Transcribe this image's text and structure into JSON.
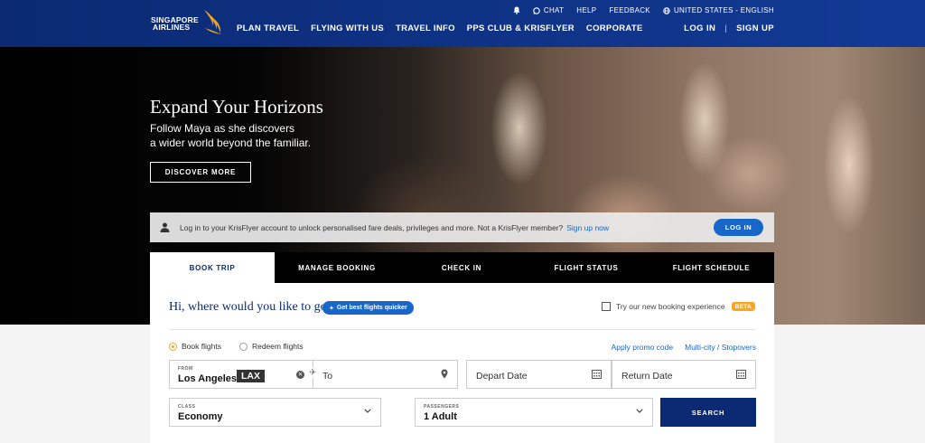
{
  "header": {
    "brand_line1": "SINGAPORE",
    "brand_line2": "AIRLINES",
    "nav": [
      "PLAN TRAVEL",
      "FLYING WITH US",
      "TRAVEL INFO",
      "PPS CLUB & KRISFLYER",
      "CORPORATE"
    ],
    "utility": {
      "chat": "CHAT",
      "help": "HELP",
      "feedback": "FEEDBACK",
      "region": "UNITED STATES - ENGLISH"
    },
    "login": "LOG IN",
    "signup": "SIGN UP",
    "colors": {
      "header_blue": "#0b2a73",
      "accent_gold": "#f6a623",
      "link_blue": "#1866c8"
    }
  },
  "hero": {
    "title": "Expand Your Horizons",
    "subtitle_line1": "Follow Maya as she discovers",
    "subtitle_line2": "a wider world beyond the familiar.",
    "button": "DISCOVER MORE"
  },
  "banner": {
    "message": "Log in to your KrisFlyer account to unlock personalised fare deals, privileges and more. Not a KrisFlyer member?",
    "link": "Sign up now",
    "button": "LOG IN"
  },
  "tabs": [
    "BOOK TRIP",
    "MANAGE BOOKING",
    "CHECK IN",
    "FLIGHT STATUS",
    "FLIGHT SCHEDULE"
  ],
  "booking": {
    "greeting": "Hi, where would you like to go?",
    "quick_pill": "Get best flights quicker",
    "try_new": "Try our new booking experience",
    "beta": "BETA",
    "radios": {
      "book": "Book flights",
      "redeem": "Redeem flights"
    },
    "promo": "Apply promo code",
    "multicity": "Multi-city / Stopovers",
    "from_label": "FROM",
    "from_city": "Los Angeles",
    "from_code": "LAX",
    "to_placeholder": "To",
    "depart_placeholder": "Depart Date",
    "return_placeholder": "Return Date",
    "class_label": "CLASS",
    "class_value": "Economy",
    "passengers_label": "PASSENGERS",
    "passengers_value": "1 Adult",
    "search": "SEARCH"
  }
}
